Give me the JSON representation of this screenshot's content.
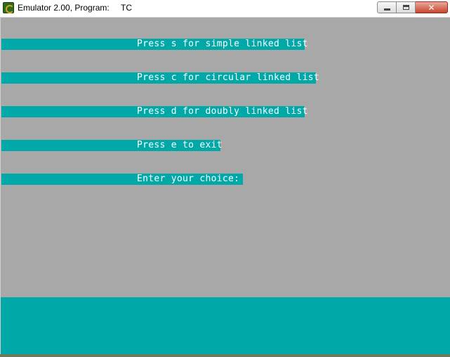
{
  "window": {
    "title": "Emulator 2.00, Program:",
    "program": "TC",
    "minimize_label": "",
    "maximize_label": "",
    "close_label": "✕"
  },
  "screen": {
    "background": "#a8a8a8",
    "highlight": "#00a8a8",
    "menu": [
      {
        "text": "Press s for simple linked list"
      },
      {
        "text": "Press c for circular linked list"
      },
      {
        "text": "Press d for doubly linked list"
      },
      {
        "text": "Press e to exit"
      },
      {
        "text": "Enter your choice: "
      }
    ]
  }
}
